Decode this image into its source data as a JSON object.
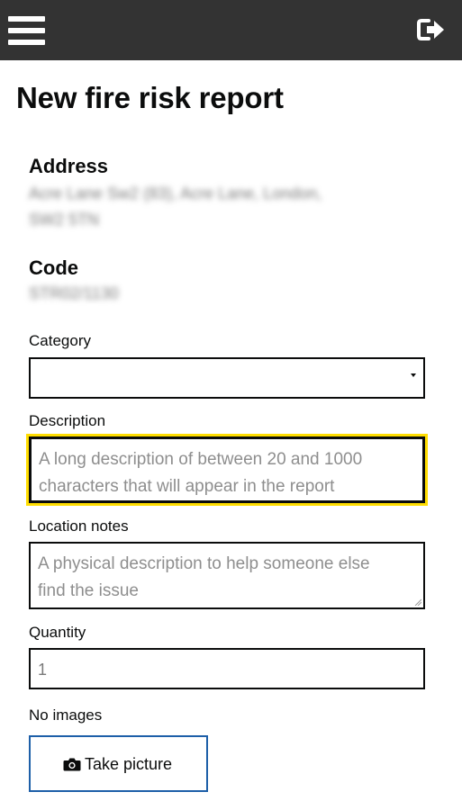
{
  "header": {
    "menu_icon": "hamburger-menu-icon",
    "signout_icon": "sign-out-icon"
  },
  "page": {
    "title": "New fire risk report"
  },
  "address": {
    "label": "Address",
    "line1": "Acre Lane Sw2 (83), Acre Lane, London,",
    "line2": "SW2 5TN"
  },
  "code": {
    "label": "Code",
    "value": "STR02/1130"
  },
  "form": {
    "category": {
      "label": "Category",
      "value": ""
    },
    "description": {
      "label": "Description",
      "placeholder_line1": "A long description of between 20 and 1000",
      "placeholder_line2": "characters that will appear in the report"
    },
    "location_notes": {
      "label": "Location notes",
      "placeholder_line1": "A physical description to help someone else",
      "placeholder_line2": "find the issue"
    },
    "quantity": {
      "label": "Quantity",
      "value": "1"
    },
    "images": {
      "status": "No images",
      "button_label": "Take picture",
      "button_icon": "camera-icon"
    }
  },
  "colors": {
    "topbar": "#333333",
    "focus": "#ffdd00",
    "button_border": "#1d5fa8",
    "placeholder": "#8e8e8e"
  }
}
